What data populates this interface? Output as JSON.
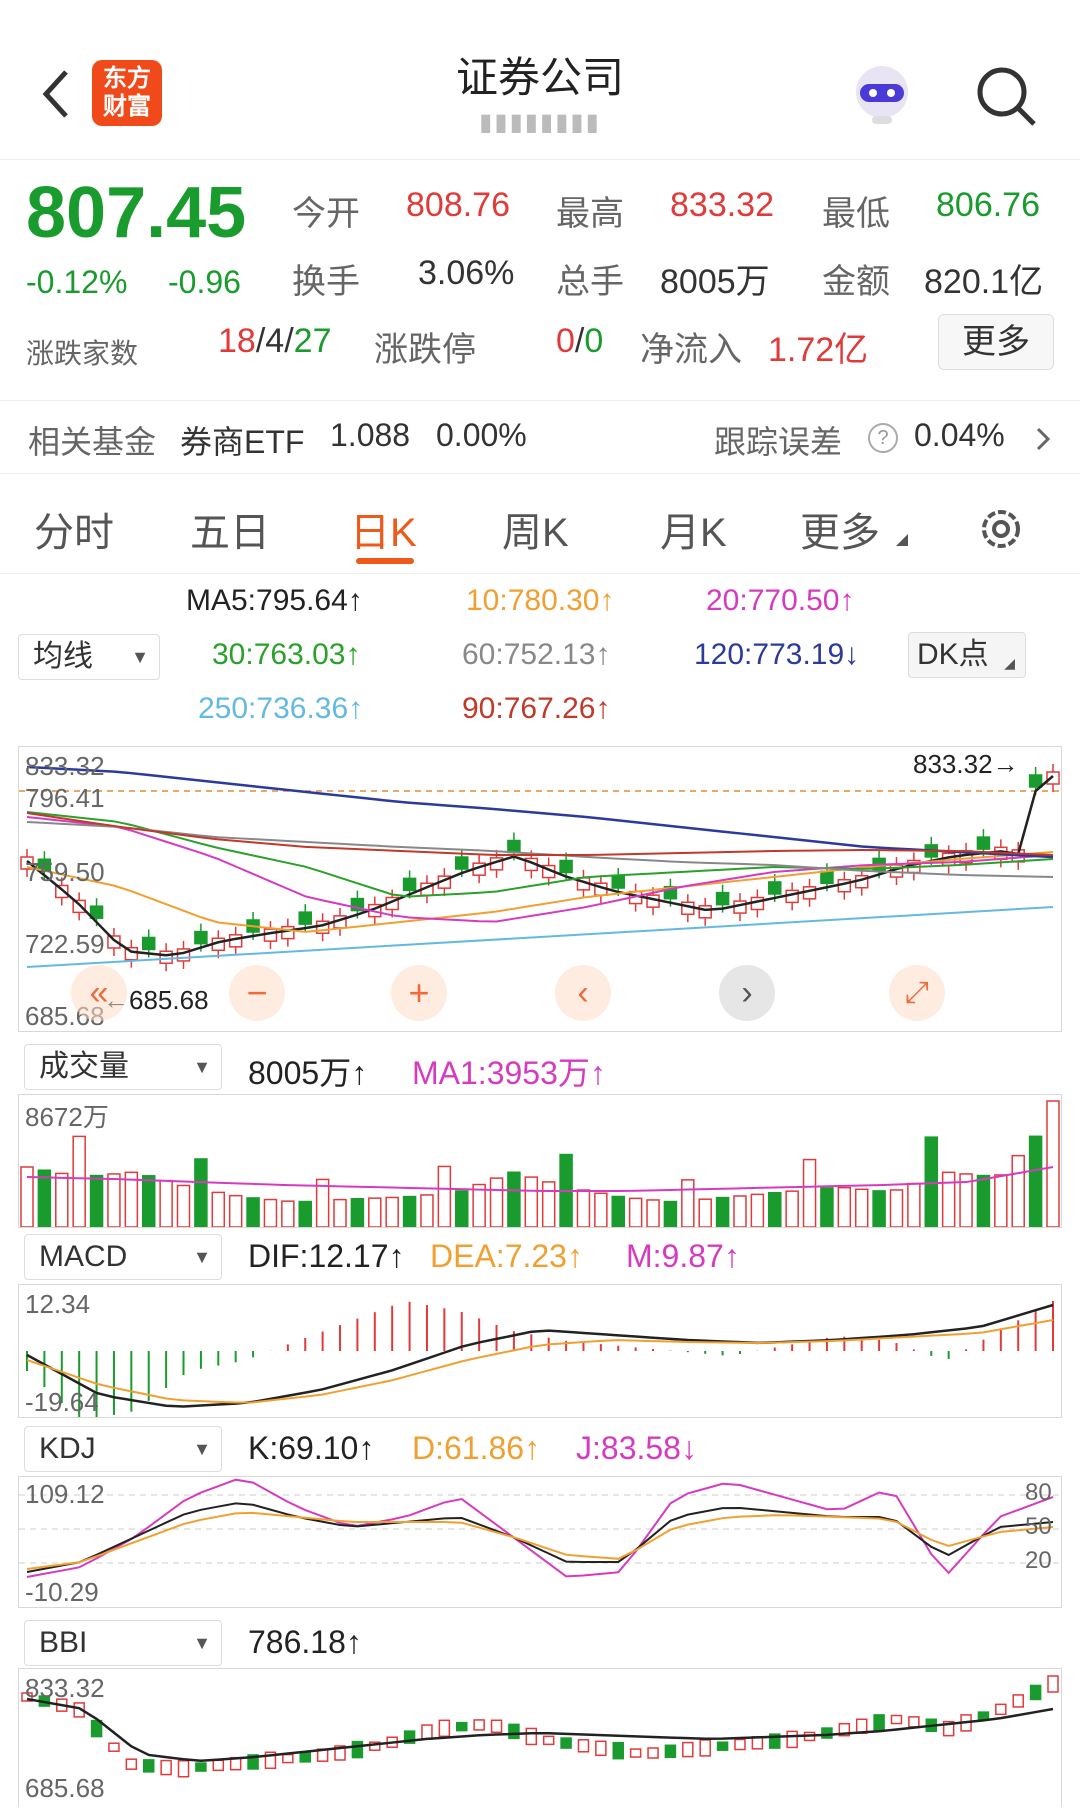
{
  "header": {
    "back_icon": "chevron-left-icon",
    "logo_text": [
      "东方",
      "财富"
    ],
    "title": "证券公司",
    "subtitle": "▮▮▮▮▮▮▮▮",
    "robot_icon": "robot-avatar-icon",
    "search_icon": "search-icon"
  },
  "quote": {
    "price": "807.45",
    "change_pct": "-0.12%",
    "change": "-0.96",
    "open_label": "今开",
    "open": "808.76",
    "high_label": "最高",
    "high": "833.32",
    "low_label": "最低",
    "low": "806.76",
    "turnover_label": "换手",
    "turnover": "3.06%",
    "volume_label": "总手",
    "volume": "8005万",
    "amount_label": "金额",
    "amount": "820.1亿",
    "adv_label": "涨跌家数",
    "adv_up": "18",
    "adv_flat": "4",
    "adv_down": "27",
    "sep": "/",
    "limit_label": "涨跌停",
    "limit_up": "0",
    "limit_down": "0",
    "inflow_label": "净流入",
    "inflow": "1.72亿",
    "more_button": "更多"
  },
  "fund": {
    "label": "相关基金",
    "name": "券商ETF",
    "price": "1.088",
    "pct": "0.00%",
    "error_label": "跟踪误差",
    "help_icon": "?",
    "error": "0.04%"
  },
  "tabs": [
    "分时",
    "五日",
    "日K",
    "周K",
    "月K",
    "更多"
  ],
  "active_tab": 2,
  "ma": {
    "selector": "均线",
    "dk_button": "DK点",
    "ma5": "MA5:795.64",
    "ma10": "10:780.30",
    "ma20": "20:770.50",
    "ma30": "30:763.03",
    "ma60": "60:752.13",
    "ma120": "120:773.19",
    "ma250": "250:736.36",
    "ma90": "90:767.26"
  },
  "kline": {
    "hi_label": "833.32",
    "ref_label": "796.41",
    "mid_label": "759.50",
    "low2_label": "722.59",
    "min_label": "685.68",
    "hi_mark": "833.32",
    "lo_mark": "685.68"
  },
  "volume": {
    "selector": "成交量",
    "value": "8005万",
    "ma1": "MA1:3953万",
    "axis_max": "8672万"
  },
  "macd": {
    "selector": "MACD",
    "dif": "DIF:12.17",
    "dea": "DEA:7.23",
    "m": "M:9.87",
    "axis_max": "12.34",
    "axis_min": "-19.64"
  },
  "kdj": {
    "selector": "KDJ",
    "k": "K:69.10",
    "d": "D:61.86",
    "j": "J:83.58",
    "axis_max": "109.12",
    "axis_min": "-10.29",
    "lvl80": "80",
    "lvl50": "50",
    "lvl20": "20"
  },
  "bbi": {
    "selector": "BBI",
    "value": "786.18",
    "axis_max": "833.32",
    "axis_min": "685.68"
  },
  "colors": {
    "up": "#e03a3a",
    "down": "#1a9b2e",
    "ma5": "#222222",
    "ma10": "#f0a030",
    "ma20": "#d63bbf",
    "ma30": "#2aa12a",
    "ma60": "#888888",
    "ma120": "#2c3a9c",
    "ma250": "#63b9e0",
    "ma90": "#c0392b"
  }
}
